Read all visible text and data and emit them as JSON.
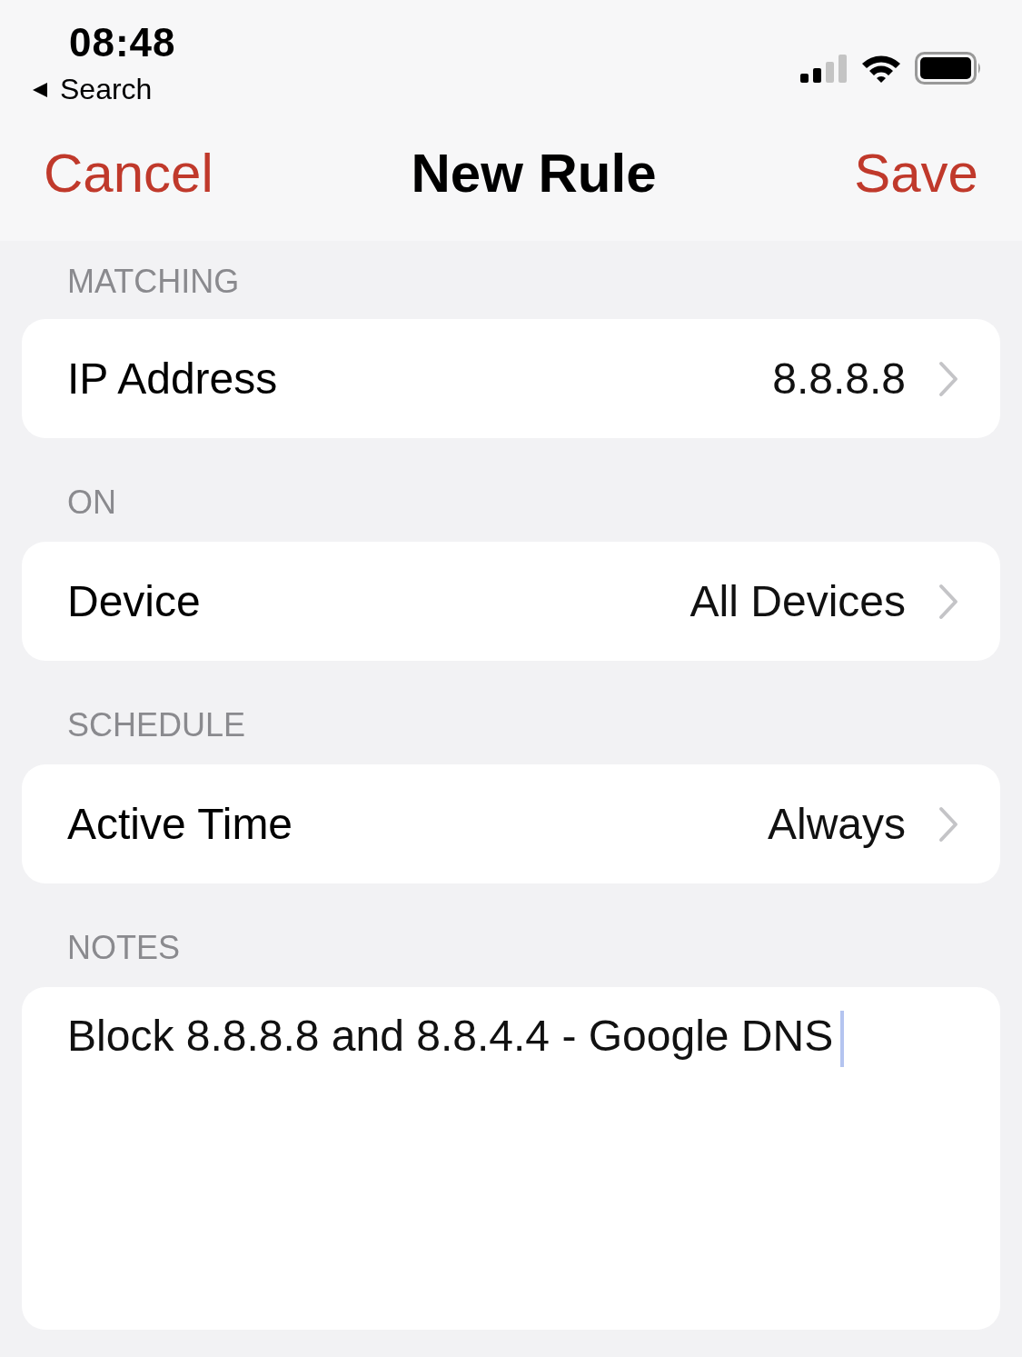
{
  "status_bar": {
    "time": "08:48",
    "back_label": "Search"
  },
  "nav": {
    "cancel": "Cancel",
    "title": "New Rule",
    "save": "Save"
  },
  "sections": [
    {
      "header": "MATCHING",
      "rows": [
        {
          "label": "IP Address",
          "value": "8.8.8.8"
        }
      ]
    },
    {
      "header": "ON",
      "rows": [
        {
          "label": "Device",
          "value": "All Devices"
        }
      ]
    },
    {
      "header": "SCHEDULE",
      "rows": [
        {
          "label": "Active Time",
          "value": "Always"
        }
      ]
    }
  ],
  "notes": {
    "header": "NOTES",
    "value": "Block 8.8.8.8 and 8.8.4.4 - Google DNS"
  }
}
